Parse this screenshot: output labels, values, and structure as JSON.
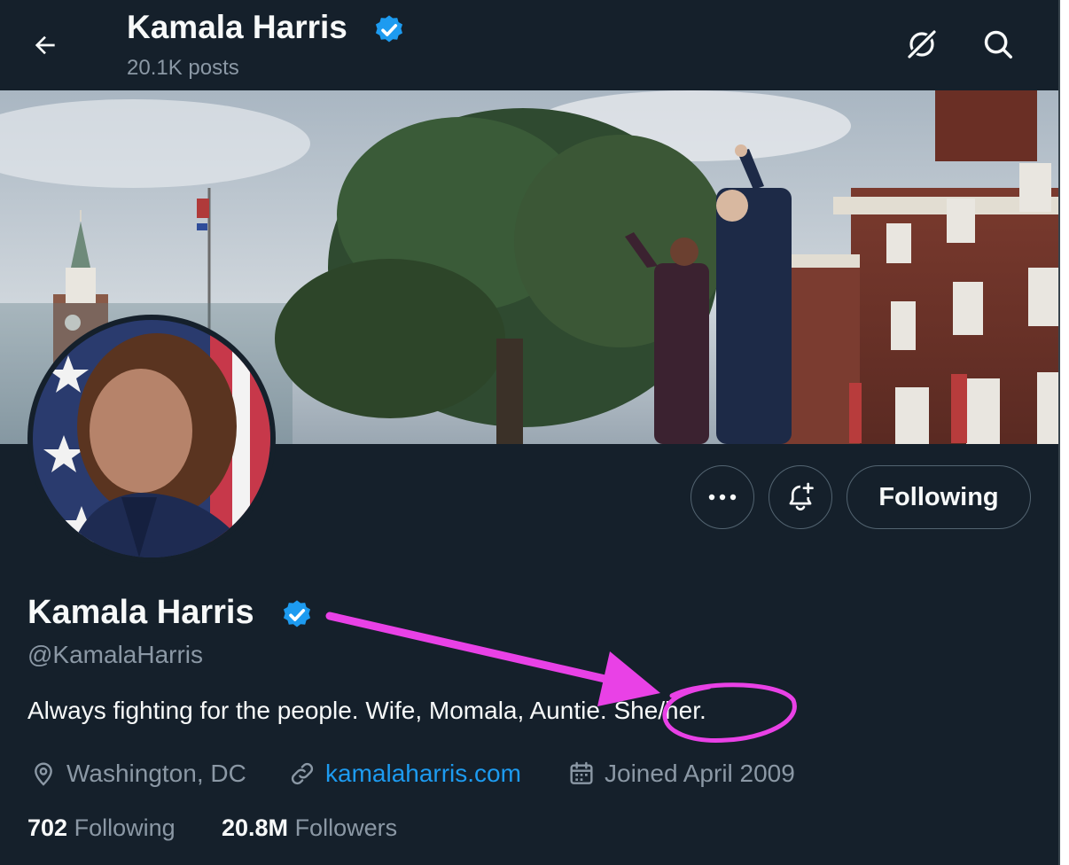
{
  "header": {
    "name": "Kamala Harris",
    "posts": "20.1K posts",
    "icons": [
      "back-arrow-icon",
      "grok-icon",
      "search-icon"
    ]
  },
  "profile": {
    "name": "Kamala Harris",
    "handle": "@KamalaHarris",
    "bio_main": "Always fighting for the people. Wife, Momala, Auntie.",
    "bio_pronouns": "She/her.",
    "location": "Washington, DC",
    "website": "kamalaharris.com",
    "joined": "Joined April 2009",
    "following_count": "702",
    "following_label": "Following",
    "followers_count": "20.8M",
    "followers_label": "Followers"
  },
  "actions": {
    "more_icon": "more-icon",
    "notify_icon": "bell-plus-icon",
    "following_button": "Following"
  },
  "colors": {
    "background": "#15202b",
    "verified": "#1d9bf0",
    "link": "#1d9bf0",
    "annotation": "#e941e6",
    "muted_text": "#8b98a5"
  }
}
